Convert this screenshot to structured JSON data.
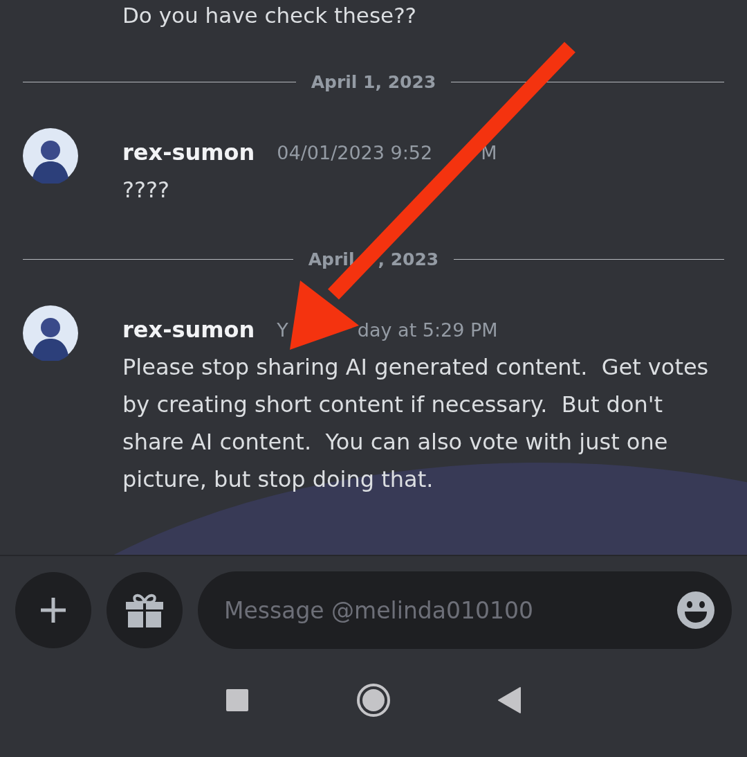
{
  "top_message": {
    "text": "Do you have check these??"
  },
  "feed": [
    {
      "kind": "divider",
      "label_parts": [
        "April 1, 2023"
      ]
    },
    {
      "kind": "message",
      "author": "rex-sumon",
      "timestamp_parts": [
        "04/01/2023 9:52",
        "M"
      ],
      "text": "????"
    },
    {
      "kind": "divider",
      "label_parts": [
        "April",
        ", 2023"
      ]
    },
    {
      "kind": "message",
      "author": "rex-sumon",
      "timestamp_parts": [
        "Y",
        "day at 5:29 PM"
      ],
      "text": "Please stop sharing AI generated content.  Get votes by creating short content if necessary.  But don't share AI content.  You can also vote with just one picture, but stop doing that."
    }
  ],
  "composer": {
    "placeholder": "Message @melinda010100"
  }
}
